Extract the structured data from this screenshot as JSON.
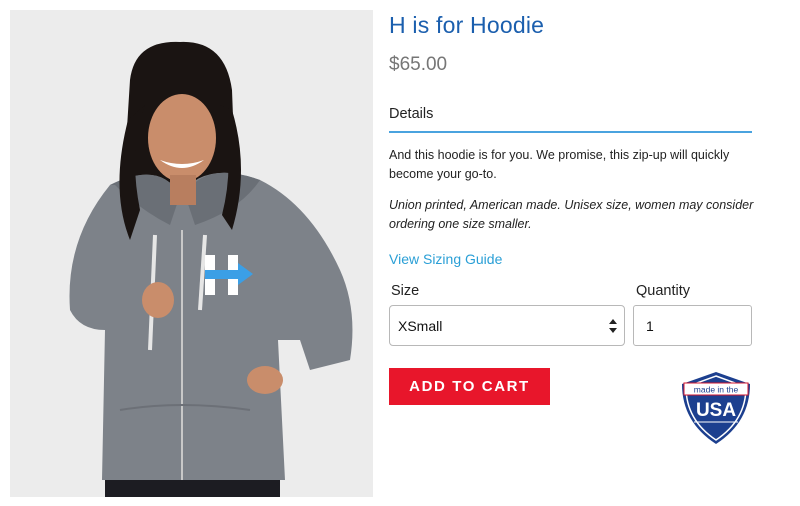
{
  "product": {
    "title": "H is for Hoodie",
    "price": "$65.00",
    "photo_icon": "model-wearing-gray-hoodie"
  },
  "details": {
    "tab_label": "Details",
    "description": "And this hoodie is for you. We promise, this  zip-up will quickly become your go-to.",
    "note": "Union printed, American made. Unisex size, women may consider ordering one size smaller.",
    "sizing_link": "View Sizing Guide"
  },
  "options": {
    "size_label": "Size",
    "size_value": "XSmall",
    "quantity_label": "Quantity",
    "quantity_value": "1"
  },
  "cart": {
    "button_label": "ADD TO CART"
  },
  "badge": {
    "line1": "made in the",
    "line2": "USA",
    "icon": "made-in-usa-shield"
  },
  "colors": {
    "title": "#1b5fae",
    "accent_rule": "#4aa3df",
    "link": "#2a9fd6",
    "cart_button": "#e8162b",
    "badge_blue": "#1c3f8f",
    "badge_red": "#d3162c"
  }
}
